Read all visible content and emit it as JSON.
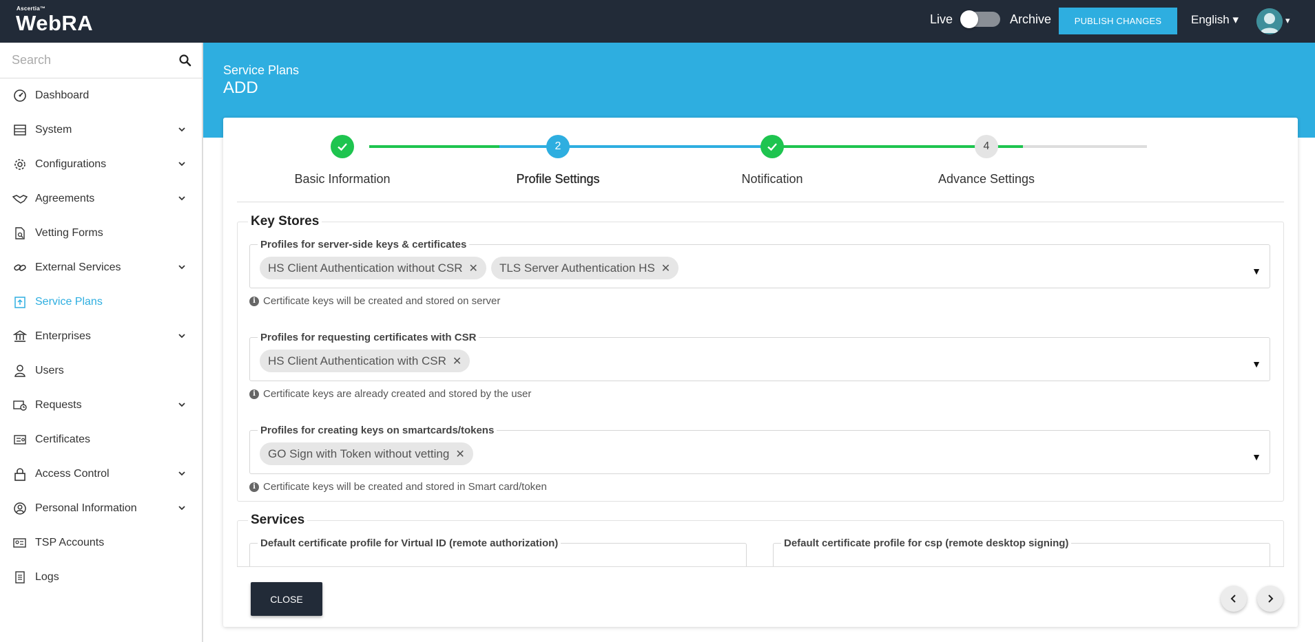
{
  "app": {
    "logo_small": "Ascertia™",
    "logo_big": "WebRA",
    "live_label": "Live",
    "archive_label": "Archive",
    "publish_label": "PUBLISH CHANGES",
    "language": "English ▾",
    "avatar_caret": "▾"
  },
  "sidebar": {
    "search_placeholder": "Search",
    "items": [
      {
        "label": "Dashboard",
        "icon": "dashboard-icon",
        "expandable": false
      },
      {
        "label": "System",
        "icon": "system-icon",
        "expandable": true
      },
      {
        "label": "Configurations",
        "icon": "gear-icon",
        "expandable": true
      },
      {
        "label": "Agreements",
        "icon": "handshake-icon",
        "expandable": true
      },
      {
        "label": "Vetting Forms",
        "icon": "form-search-icon",
        "expandable": false
      },
      {
        "label": "External Services",
        "icon": "link-icon",
        "expandable": true
      },
      {
        "label": "Service Plans",
        "icon": "service-plans-icon",
        "expandable": false,
        "active": true
      },
      {
        "label": "Enterprises",
        "icon": "bank-icon",
        "expandable": true
      },
      {
        "label": "Users",
        "icon": "user-icon",
        "expandable": false
      },
      {
        "label": "Requests",
        "icon": "requests-icon",
        "expandable": true
      },
      {
        "label": "Certificates",
        "icon": "certificate-icon",
        "expandable": false
      },
      {
        "label": "Access Control",
        "icon": "lock-icon",
        "expandable": true
      },
      {
        "label": "Personal Information",
        "icon": "person-circle-icon",
        "expandable": true
      },
      {
        "label": "TSP Accounts",
        "icon": "id-card-icon",
        "expandable": false
      },
      {
        "label": "Logs",
        "icon": "logs-icon",
        "expandable": false
      }
    ]
  },
  "page": {
    "breadcrumb": "Service Plans",
    "title": "ADD"
  },
  "stepper": {
    "steps": [
      {
        "label": "Basic Information",
        "state": "done",
        "badge": ""
      },
      {
        "label": "Profile Settings",
        "state": "current",
        "badge": "2"
      },
      {
        "label": "Notification",
        "state": "done",
        "badge": ""
      },
      {
        "label": "Advance Settings",
        "state": "pending",
        "badge": "4"
      }
    ]
  },
  "key_stores": {
    "title": "Key Stores",
    "server_side": {
      "label": "Profiles for server-side keys & certificates",
      "chips": [
        "HS Client Authentication without CSR",
        "TLS Server Authentication HS"
      ],
      "hint": "Certificate keys will be created and stored on server"
    },
    "csr": {
      "label": "Profiles for requesting certificates with CSR",
      "chips": [
        "HS Client Authentication with CSR"
      ],
      "hint": "Certificate keys are already created and stored by the user"
    },
    "smartcards": {
      "label": "Profiles for creating keys on smartcards/tokens",
      "chips": [
        "GO Sign with Token without vetting"
      ],
      "hint": "Certificate keys will be created and stored in Smart card/token"
    }
  },
  "services": {
    "title": "Services",
    "virtual_id_label": "Default certificate profile for Virtual ID (remote authorization)",
    "csp_label": "Default certificate profile for csp (remote desktop signing)"
  },
  "footer": {
    "close_label": "CLOSE"
  },
  "colors": {
    "accent": "#2eaee0",
    "topbar": "#222b38",
    "success": "#1ec44f"
  }
}
